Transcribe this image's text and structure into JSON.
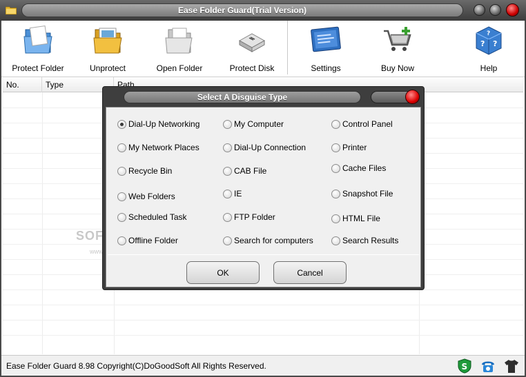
{
  "window": {
    "title": "Ease Folder Guard(Trial Version)"
  },
  "toolbar": {
    "items": [
      {
        "label": "Protect Folder",
        "icon": "protect-folder-icon"
      },
      {
        "label": "Unprotect",
        "icon": "unprotect-icon"
      },
      {
        "label": "Open Folder",
        "icon": "open-folder-icon"
      },
      {
        "label": "Protect Disk",
        "icon": "protect-disk-icon"
      },
      {
        "label": "Settings",
        "icon": "settings-icon"
      },
      {
        "label": "Buy Now",
        "icon": "cart-icon"
      },
      {
        "label": "Help",
        "icon": "help-icon"
      }
    ]
  },
  "list": {
    "columns": [
      "No.",
      "Type",
      "Path"
    ]
  },
  "watermark": {
    "brand": "SOFTPEDIA",
    "url": "www.softpedia.com"
  },
  "dialog": {
    "title": "Select A Disguise Type",
    "options": [
      {
        "label": "Dial-Up Networking",
        "selected": true
      },
      {
        "label": "My Computer",
        "selected": false
      },
      {
        "label": "Control Panel",
        "selected": false
      },
      {
        "label": "My Network Places",
        "selected": false
      },
      {
        "label": "Dial-Up Connection",
        "selected": false
      },
      {
        "label": "Printer",
        "selected": false
      },
      {
        "label": "Recycle Bin",
        "selected": false
      },
      {
        "label": "CAB File",
        "selected": false
      },
      {
        "label": "Cache Files",
        "selected": false
      },
      {
        "label": "Web Folders",
        "selected": false
      },
      {
        "label": "IE",
        "selected": false
      },
      {
        "label": "Snapshot File",
        "selected": false
      },
      {
        "label": "Scheduled Task",
        "selected": false
      },
      {
        "label": "FTP Folder",
        "selected": false
      },
      {
        "label": "HTML File",
        "selected": false
      },
      {
        "label": "Offline Folder",
        "selected": false
      },
      {
        "label": "Search for computers",
        "selected": false
      },
      {
        "label": "Search Results",
        "selected": false
      }
    ],
    "ok_label": "OK",
    "cancel_label": "Cancel"
  },
  "status": {
    "text": "Ease Folder Guard 8.98 Copyright(C)DoGoodSoft All Rights Reserved.",
    "icons": [
      "shield-s-icon",
      "phone-icon",
      "shirt-icon"
    ]
  },
  "colors": {
    "titlebar": "#4a4a4a",
    "close_button": "#d00000",
    "dialog_frame": "#3e3e3e"
  }
}
